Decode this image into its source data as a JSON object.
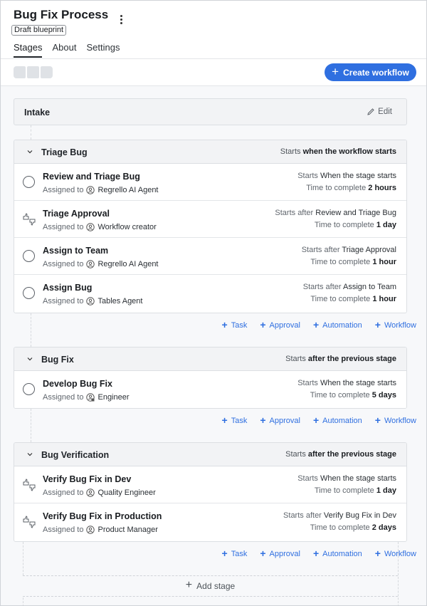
{
  "header": {
    "title": "Bug Fix Process",
    "badge": "Draft blueprint",
    "tabs": [
      {
        "label": "Stages",
        "active": true
      },
      {
        "label": "About",
        "active": false
      },
      {
        "label": "Settings",
        "active": false
      }
    ]
  },
  "toolbar": {
    "create_label": "Create workflow",
    "accent": "#2f6fe0"
  },
  "intake": {
    "title": "Intake",
    "edit_label": "Edit"
  },
  "labels": {
    "assigned_to": "Assigned to",
    "starts": "Starts",
    "starts_after": "Starts after",
    "time_to_complete": "Time to complete",
    "add_task": "Task",
    "add_approval": "Approval",
    "add_automation": "Automation",
    "add_workflow": "Workflow",
    "add_stage": "Add stage"
  },
  "stages": [
    {
      "name": "Triage Bug",
      "starts_prefix": "Starts",
      "starts_value": "when the workflow starts",
      "tasks": [
        {
          "name": "Review and Triage Bug",
          "kind": "task",
          "assignee": "Regrello AI Agent",
          "starts_label": "Starts",
          "starts_value": "When the stage starts",
          "time": "2 hours"
        },
        {
          "name": "Triage Approval",
          "kind": "approval",
          "assignee": "Workflow creator",
          "starts_label": "Starts after",
          "starts_value": "Review and Triage Bug",
          "time": "1 day"
        },
        {
          "name": "Assign to Team",
          "kind": "task",
          "assignee": "Regrello AI Agent",
          "starts_label": "Starts after",
          "starts_value": "Triage Approval",
          "time": "1 hour"
        },
        {
          "name": "Assign Bug",
          "kind": "task",
          "assignee": "Tables Agent",
          "starts_label": "Starts after",
          "starts_value": "Assign to Team",
          "time": "1 hour"
        }
      ]
    },
    {
      "name": "Bug Fix",
      "starts_prefix": "Starts",
      "starts_value": "after the previous stage",
      "tasks": [
        {
          "name": "Develop Bug Fix",
          "kind": "task",
          "assignee": "Engineer",
          "starts_label": "Starts",
          "starts_value": "When the stage starts",
          "time": "5 days"
        }
      ]
    },
    {
      "name": "Bug Verification",
      "starts_prefix": "Starts",
      "starts_value": "after the previous stage",
      "tasks": [
        {
          "name": "Verify Bug Fix in Dev",
          "kind": "approval",
          "assignee": "Quality Engineer",
          "starts_label": "Starts",
          "starts_value": "When the stage starts",
          "time": "1 day"
        },
        {
          "name": "Verify Bug Fix in Production",
          "kind": "approval",
          "assignee": "Product Manager",
          "starts_label": "Starts after",
          "starts_value": "Verify Bug Fix in Dev",
          "time": "2 days"
        }
      ]
    }
  ]
}
